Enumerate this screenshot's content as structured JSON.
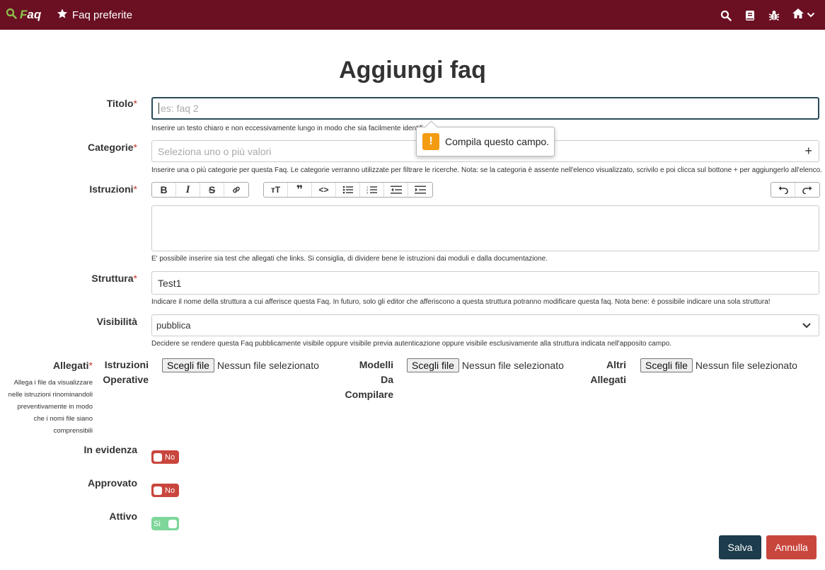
{
  "navbar": {
    "brand_first": "F",
    "brand_rest": "aq",
    "favorites_label": "Faq preferite",
    "icons": [
      "search-icon",
      "book-icon",
      "bug-icon",
      "home-icon",
      "chevron-down-icon"
    ]
  },
  "page": {
    "title": "Aggiungi faq"
  },
  "form": {
    "titolo": {
      "label": "Titolo",
      "placeholder": "es: faq 2",
      "help": "Inserire un testo chiaro e non eccessivamente lungo in modo che sia facilmente identifi"
    },
    "tooltip": {
      "text": "Compila questo campo."
    },
    "categorie": {
      "label": "Categorie",
      "placeholder": "Seleziona uno o più valori",
      "add_symbol": "+",
      "help": "Inserire una o più categorie per questa Faq. Le categorie verranno utilizzate per filtrare le ricerche. Nota: se la categoria è assente nell'elenco visualizzato, scrivilo e poi clicca sul bottone + per aggiungerlo all'elenco."
    },
    "istruzioni": {
      "label": "Istruzioni",
      "help": "E' possibile inserire sia test che allegati che links. Si consiglia, di dividere bene le istruzioni dai moduli e dalla documentazione."
    },
    "struttura": {
      "label": "Struttura",
      "value": "Test1",
      "help": "Indicare il nome della struttura a cui afferisce questa Faq. In futuro, solo gli editor che afferiscono a questa struttura potranno modificare questa faq. Nota bene: è possibile indicare una sola struttura!"
    },
    "visibilita": {
      "label": "Visibilità",
      "value": "pubblica",
      "help": "Decidere se rendere questa Faq pubblicamente visibile oppure visibile previa autenticazione oppure visibile esclusivamente alla struttura indicata nell'apposito campo."
    },
    "allegati": {
      "label": "Allegati",
      "help_lines": [
        "Allega i file da visualizzare",
        "nelle istruzioni rinominandoli",
        "preventivamente in modo",
        "che i nomi file siano",
        "comprensibili"
      ],
      "choose_label": "Scegli file",
      "no_file": "Nessun file selezionato",
      "groups": [
        {
          "label_lines": [
            "Istruzioni",
            "Operative"
          ]
        },
        {
          "label_lines": [
            "Modelli",
            "Da",
            "Compilare"
          ]
        },
        {
          "label_lines": [
            "Altri",
            "Allegati"
          ]
        }
      ]
    },
    "in_evidenza": {
      "label": "In evidenza",
      "state": "No"
    },
    "approvato": {
      "label": "Approvato",
      "state": "No"
    },
    "attivo": {
      "label": "Attivo",
      "state": "Si"
    }
  },
  "buttons": {
    "save": "Salva",
    "cancel": "Annulla"
  },
  "colors": {
    "navbar": "#6b0f23",
    "save": "#1d3c4c",
    "cancel": "#c9463d",
    "toggle_on": "#7ed69a",
    "required": "#c0392b"
  }
}
